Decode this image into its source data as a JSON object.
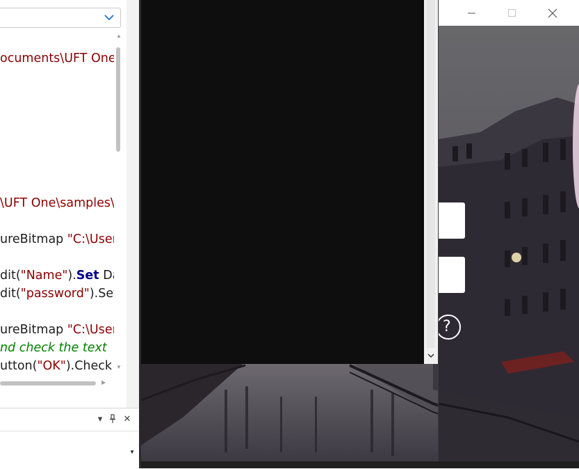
{
  "editor": {
    "lines": [
      {
        "parts": [
          {
            "t": "ocuments\\UFT One",
            "c": "str"
          }
        ]
      },
      {
        "parts": [
          {
            "t": "\\UFT One\\samples\\",
            "c": "str"
          }
        ]
      },
      {
        "parts": [
          {
            "t": "ureBitmap ",
            "c": "plain"
          },
          {
            "t": "\"C:\\User",
            "c": "str"
          }
        ]
      },
      {
        "parts": [
          {
            "t": "dit(",
            "c": "plain"
          },
          {
            "t": "\"Name\"",
            "c": "str"
          },
          {
            "t": ").",
            "c": "plain"
          },
          {
            "t": "Set",
            "c": "kw"
          },
          {
            "t": " Da",
            "c": "plain"
          }
        ]
      },
      {
        "parts": [
          {
            "t": "dit(",
            "c": "plain"
          },
          {
            "t": "\"password\"",
            "c": "str"
          },
          {
            "t": ").Set",
            "c": "plain"
          }
        ]
      },
      {
        "parts": [
          {
            "t": "ureBitmap ",
            "c": "plain"
          },
          {
            "t": "\"C:\\User",
            "c": "str"
          }
        ]
      },
      {
        "parts": [
          {
            "t": "nd check the text",
            "c": "cmt"
          }
        ]
      },
      {
        "parts": [
          {
            "t": "utton(",
            "c": "plain"
          },
          {
            "t": "\"OK\"",
            "c": "str"
          },
          {
            "t": ").Check",
            "c": "plain"
          }
        ]
      }
    ]
  },
  "panel": {
    "buttons": [
      {
        "name": "panel-dropdown-button",
        "icon": "triangle-down-icon",
        "glyph": "▾"
      },
      {
        "name": "panel-pin-button",
        "icon": "pin-icon",
        "glyph": "⊥"
      },
      {
        "name": "panel-close-button",
        "icon": "close-icon",
        "glyph": "✕"
      }
    ]
  },
  "app_window": {
    "help_symbol": "?"
  },
  "colors": {
    "string": "#8b0000",
    "keyword": "#00008b",
    "comment": "#008000",
    "console_bg": "#0e0e0e"
  }
}
